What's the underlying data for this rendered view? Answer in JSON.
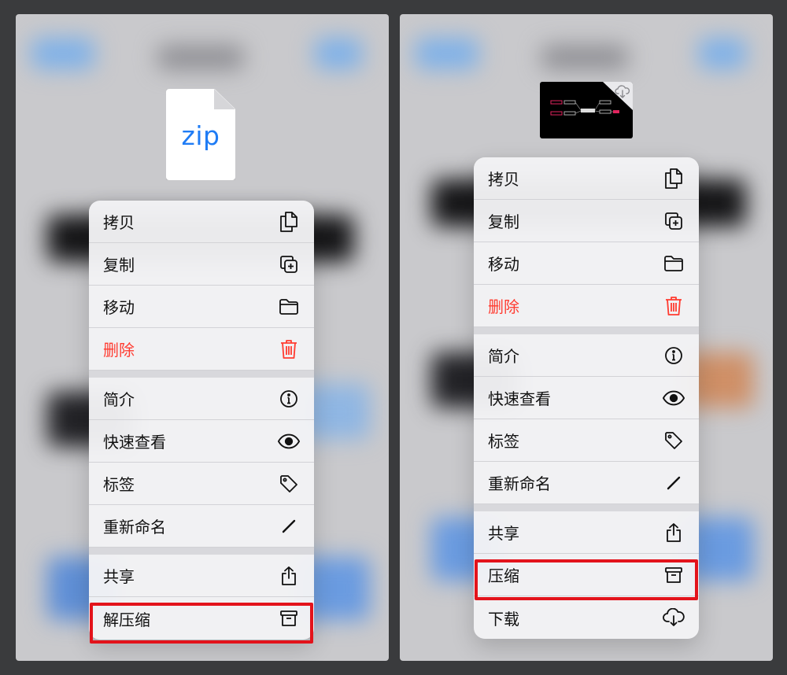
{
  "left_panel": {
    "file_type_label": "zip",
    "menu": {
      "group1": [
        {
          "label": "拷贝",
          "icon": "copy-doc-icon"
        },
        {
          "label": "复制",
          "icon": "duplicate-icon"
        },
        {
          "label": "移动",
          "icon": "folder-icon"
        },
        {
          "label": "删除",
          "icon": "trash-icon",
          "destructive": true
        }
      ],
      "group2": [
        {
          "label": "简介",
          "icon": "info-icon"
        },
        {
          "label": "快速查看",
          "icon": "eye-icon"
        },
        {
          "label": "标签",
          "icon": "tag-icon"
        },
        {
          "label": "重新命名",
          "icon": "pencil-icon"
        }
      ],
      "group3": [
        {
          "label": "共享",
          "icon": "share-icon"
        },
        {
          "label": "解压缩",
          "icon": "archive-box-icon",
          "highlighted": true
        }
      ]
    }
  },
  "right_panel": {
    "menu": {
      "group1": [
        {
          "label": "拷贝",
          "icon": "copy-doc-icon"
        },
        {
          "label": "复制",
          "icon": "duplicate-icon"
        },
        {
          "label": "移动",
          "icon": "folder-icon"
        },
        {
          "label": "删除",
          "icon": "trash-icon",
          "destructive": true
        }
      ],
      "group2": [
        {
          "label": "简介",
          "icon": "info-icon"
        },
        {
          "label": "快速查看",
          "icon": "eye-icon"
        },
        {
          "label": "标签",
          "icon": "tag-icon"
        },
        {
          "label": "重新命名",
          "icon": "pencil-icon"
        }
      ],
      "group3": [
        {
          "label": "共享",
          "icon": "share-icon"
        },
        {
          "label": "压缩",
          "icon": "archive-box-icon",
          "highlighted": true
        },
        {
          "label": "下载",
          "icon": "cloud-download-icon"
        }
      ]
    }
  },
  "colors": {
    "destructive": "#ff3b30",
    "highlight_border": "#e3131b",
    "zip_label": "#1f7cf5"
  }
}
